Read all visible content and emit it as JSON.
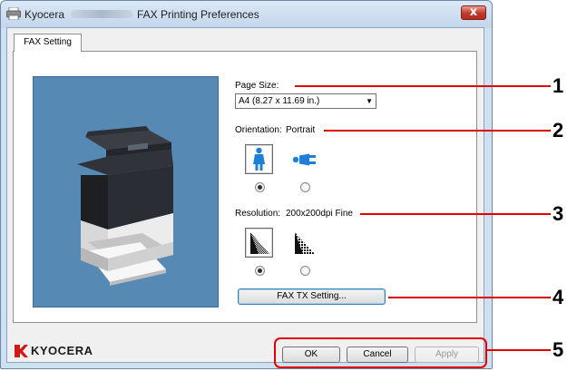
{
  "window": {
    "title_prefix": "Kyocera",
    "title_suffix": "FAX Printing Preferences",
    "close_glyph": "x"
  },
  "tabs": [
    {
      "label": "FAX Setting"
    }
  ],
  "page_size": {
    "label": "Page Size:",
    "selected": "A4 (8.27 x 11.69 in.)"
  },
  "orientation": {
    "label": "Orientation:",
    "value": "Portrait",
    "options": [
      {
        "icon": "portrait-person-icon",
        "selected": true
      },
      {
        "icon": "landscape-person-icon",
        "selected": false
      }
    ]
  },
  "resolution": {
    "label": "Resolution:",
    "value": "200x200dpi Fine",
    "options": [
      {
        "icon": "fine-resolution-icon",
        "selected": true
      },
      {
        "icon": "normal-resolution-icon",
        "selected": false
      }
    ]
  },
  "buttons": {
    "fax_tx": "FAX TX Setting...",
    "ok": "OK",
    "cancel": "Cancel",
    "apply": "Apply"
  },
  "logo": {
    "text": "KYOCERA"
  },
  "callouts": [
    "1",
    "2",
    "3",
    "4",
    "5"
  ],
  "colors": {
    "callout": "#e00000",
    "preview_bg": "#5789b5",
    "icon_accent": "#1e7fd6"
  }
}
